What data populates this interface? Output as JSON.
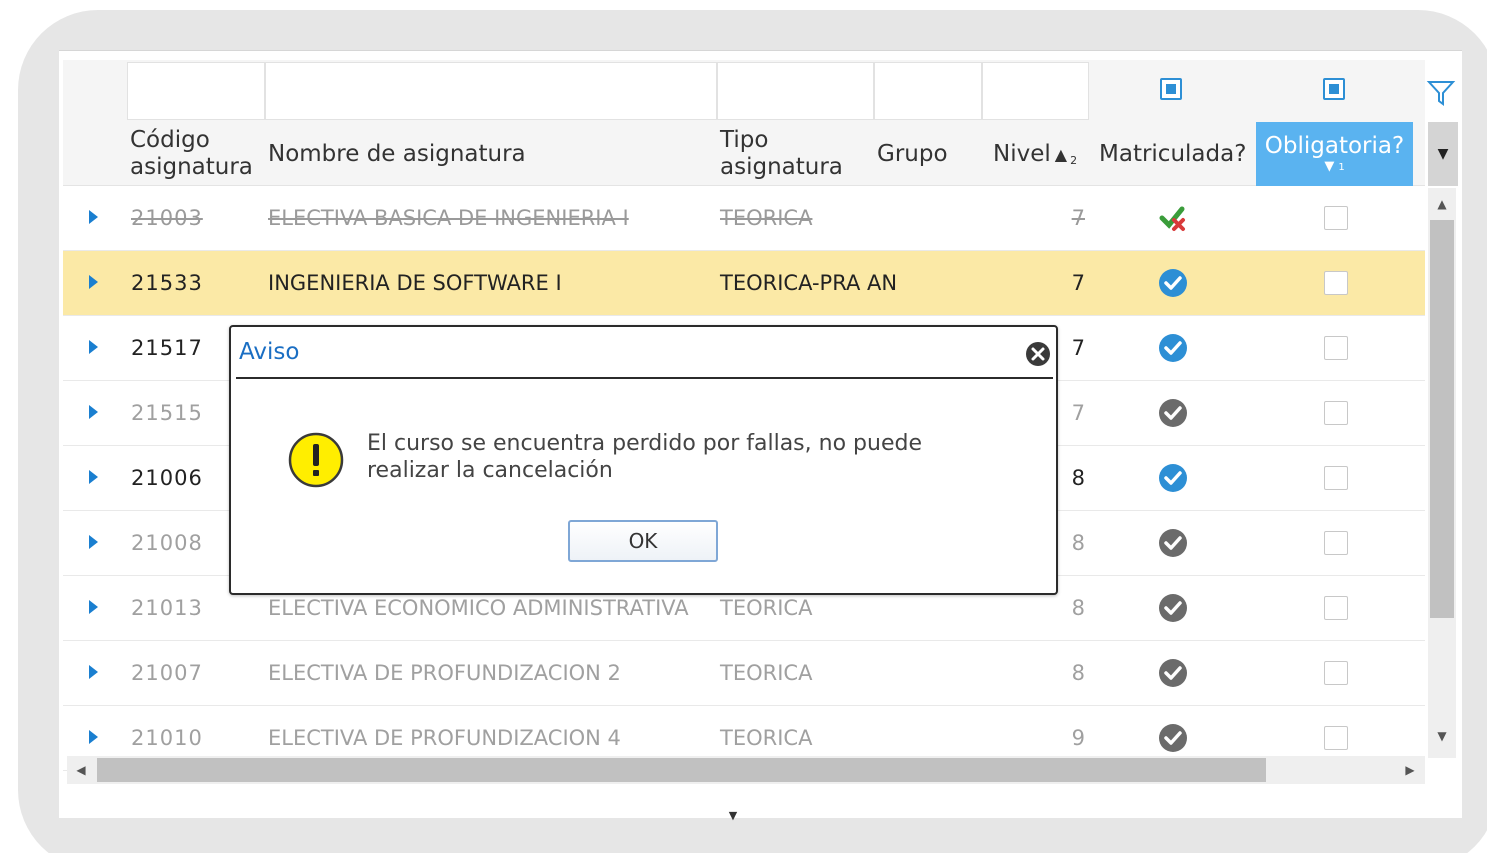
{
  "grid": {
    "columns": [
      {
        "key": "codigo",
        "label": "Código\nasignatura"
      },
      {
        "key": "nombre",
        "label": "Nombre de asignatura"
      },
      {
        "key": "tipo",
        "label": "Tipo\nasignatura"
      },
      {
        "key": "grupo",
        "label": "Grupo"
      },
      {
        "key": "nivel",
        "label": "Nivel",
        "sort_order": "2"
      },
      {
        "key": "matriculada",
        "label": "Matriculada?"
      },
      {
        "key": "obligatoria",
        "label": "Obligatoria?",
        "sort_order": "1"
      }
    ],
    "rows": [
      {
        "codigo": "21003",
        "nombre": "ELECTIVA BASICA DE INGENIERIA I",
        "tipo": "TEORICA",
        "nivel": "7",
        "style": "strike",
        "matriculada_icon": "check-red-x-icon"
      },
      {
        "codigo": "21533",
        "nombre": "INGENIERIA DE SOFTWARE I",
        "tipo": "TEORICA-PRA AN",
        "nivel": "7",
        "style": "normal",
        "matriculada_icon": "check-blue-icon"
      },
      {
        "codigo": "21517",
        "nombre": "",
        "tipo": "",
        "nivel": "7",
        "style": "normal",
        "matriculada_icon": "check-blue-icon"
      },
      {
        "codigo": "21515",
        "nombre": "",
        "tipo": "",
        "nivel": "7",
        "style": "dim",
        "matriculada_icon": "check-gray-icon"
      },
      {
        "codigo": "21006",
        "nombre": "",
        "tipo": "",
        "nivel": "8",
        "style": "normal",
        "matriculada_icon": "check-blue-icon"
      },
      {
        "codigo": "21008",
        "nombre": "",
        "tipo": "",
        "nivel": "8",
        "style": "dim",
        "matriculada_icon": "check-gray-icon"
      },
      {
        "codigo": "21013",
        "nombre": "ELECTIVA ECONOMICO ADMINISTRATIVA",
        "tipo": "TEORICA",
        "nivel": "8",
        "style": "dim",
        "matriculada_icon": "check-gray-icon"
      },
      {
        "codigo": "21007",
        "nombre": "ELECTIVA DE PROFUNDIZACION 2",
        "tipo": "TEORICA",
        "nivel": "8",
        "style": "dim",
        "matriculada_icon": "check-gray-icon"
      },
      {
        "codigo": "21010",
        "nombre": "ELECTIVA DE PROFUNDIZACION 4",
        "tipo": "TEORICA",
        "nivel": "9",
        "style": "dim",
        "matriculada_icon": "check-gray-icon"
      }
    ],
    "highlight_row": 1
  },
  "dialog": {
    "title": "Aviso",
    "message": "El curso se encuentra perdido por fallas, no puede realizar la cancelación",
    "ok_label": "OK",
    "icon": "warning-icon"
  },
  "colors": {
    "accent": "#5ab3f0",
    "highlight": "#fbe9a6",
    "check_blue": "#2d8fd5",
    "link_blue": "#1a6ec3"
  }
}
